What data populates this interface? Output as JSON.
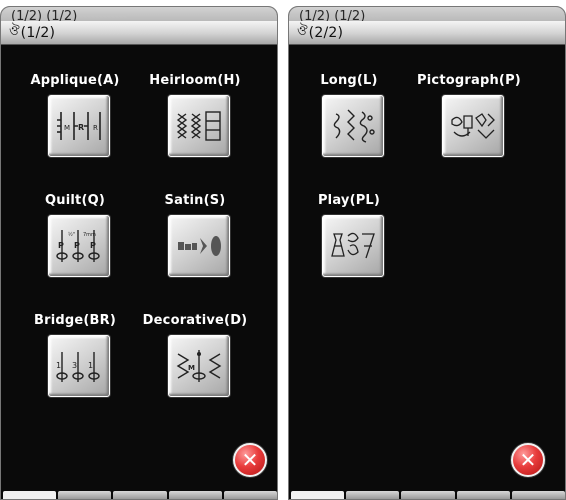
{
  "left_screen": {
    "ghost_header": "(1/2) (1/2)",
    "title": "(1/2)",
    "title_icon": "sewing-pattern-icon",
    "buttons": [
      {
        "label": "Applique(A)",
        "icon": "applique-stitch-icon"
      },
      {
        "label": "Heirloom(H)",
        "icon": "heirloom-stitch-icon"
      },
      {
        "label": "Quilt(Q)",
        "icon": "quilt-stitch-icon"
      },
      {
        "label": "Satin(S)",
        "icon": "satin-stitch-icon"
      },
      {
        "label": "Bridge(BR)",
        "icon": "bridge-stitch-icon"
      },
      {
        "label": "Decorative(D)",
        "icon": "decorative-stitch-icon"
      }
    ],
    "close_symbol": "✕"
  },
  "right_screen": {
    "ghost_header": "(1/2) (1/2)",
    "title": "(2/2)",
    "title_icon": "sewing-pattern-icon",
    "buttons": [
      {
        "label": "Long(L)",
        "icon": "long-stitch-icon"
      },
      {
        "label": "Pictograph(P)",
        "icon": "pictograph-stitch-icon"
      },
      {
        "label": "Play(PL)",
        "icon": "play-stitch-icon"
      }
    ],
    "close_symbol": "✕"
  }
}
